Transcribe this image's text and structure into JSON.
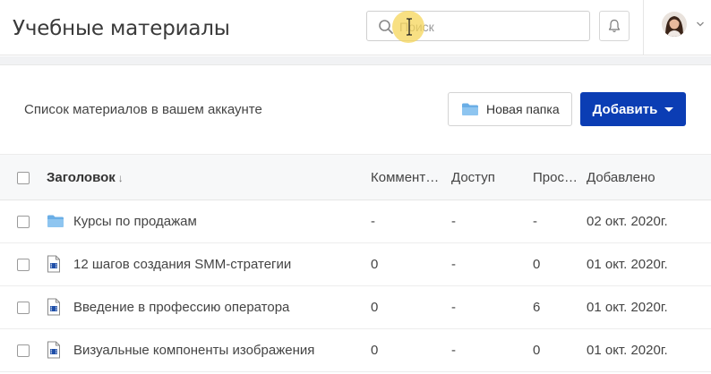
{
  "header": {
    "title": "Учебные материалы",
    "search": {
      "placeholder": "Поиск",
      "value": ""
    },
    "bell_icon": "bell-icon",
    "avatar_icon": "avatar",
    "menu_icon": "chevron-down-icon"
  },
  "toolbar": {
    "subtitle": "Список материалов в вашем аккаунте",
    "new_folder_label": "Новая папка",
    "add_label": "Добавить",
    "accent_color": "#0b3db4"
  },
  "table": {
    "columns": [
      {
        "key": "title",
        "label": "Заголовок"
      },
      {
        "key": "comments",
        "label": "Коммент…"
      },
      {
        "key": "access",
        "label": "Доступ"
      },
      {
        "key": "views",
        "label": "Прос…"
      },
      {
        "key": "added",
        "label": "Добавлено"
      }
    ],
    "sort_indicator": "↓",
    "rows": [
      {
        "icon": "folder-icon",
        "title": "Курсы по продажам",
        "comments": "-",
        "access": "-",
        "views": "-",
        "added": "02 окт. 2020г."
      },
      {
        "icon": "video-file-icon",
        "title": "12 шагов создания SMM-стратегии",
        "comments": "0",
        "access": "-",
        "views": "0",
        "added": "01 окт. 2020г."
      },
      {
        "icon": "video-file-icon",
        "title": "Введение в профессию оператора",
        "comments": "0",
        "access": "-",
        "views": "6",
        "added": "01 окт. 2020г."
      },
      {
        "icon": "video-file-icon",
        "title": "Визуальные компоненты изображения",
        "comments": "0",
        "access": "-",
        "views": "0",
        "added": "01 окт. 2020г."
      }
    ]
  }
}
